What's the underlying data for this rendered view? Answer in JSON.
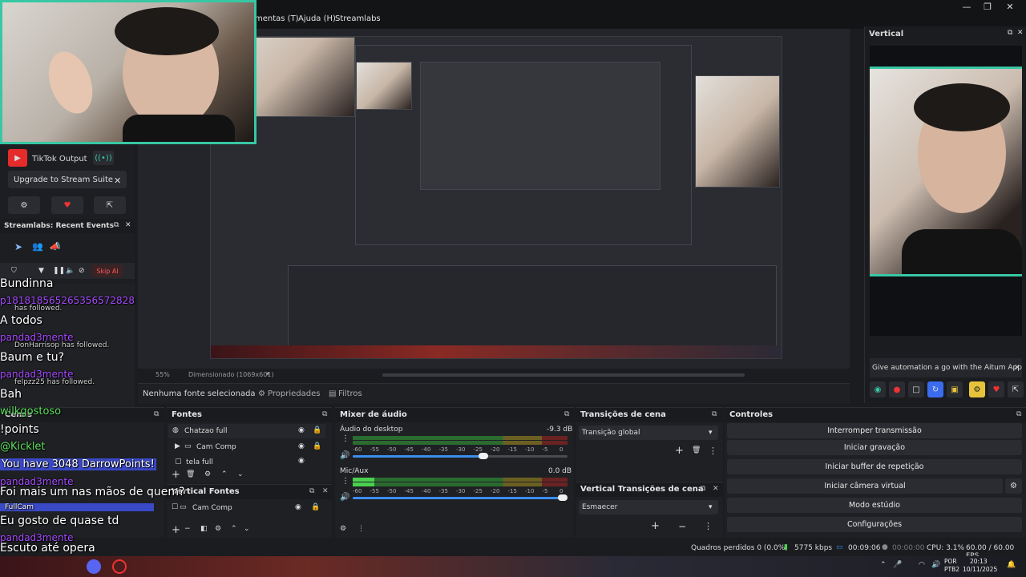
{
  "menu": {
    "items": [
      "mentas (T)",
      "Ajuda (H)",
      "Streamlabs"
    ]
  },
  "window_controls": {
    "minimize": "—",
    "restore": "❐",
    "close": "✕"
  },
  "left_panel": {
    "tiktok_label": "TikTok Output",
    "upgrade_label": "Upgrade to Stream Suite",
    "recent_events_title": "Streamlabs: Recent Events",
    "skip_label": "Skip Al"
  },
  "preview": {
    "zoom": "55%",
    "scaled_label": "Dimensionado (1069x601)"
  },
  "source_bar": {
    "no_source": "Nenhuma fonte selecionada",
    "properties": "Propriedades",
    "filters": "Filtros"
  },
  "scenes": {
    "title": "Cenas"
  },
  "sources": {
    "title": "Fontes",
    "items": [
      "Chatzao full",
      "Cam Comp",
      "tela full"
    ]
  },
  "vertical_sources": {
    "title": "Vertical Fontes",
    "items": [
      "Cam Comp"
    ]
  },
  "mixer": {
    "title": "Mixer de áudio",
    "channels": [
      {
        "name": "Áudio do desktop",
        "db": "-9.3 dB",
        "level": 0.0,
        "volume": 0.63
      },
      {
        "name": "Mic/Aux",
        "db": "0.0 dB",
        "level": 0.1,
        "volume": 1.0
      }
    ],
    "ticks": [
      "-60",
      "-55",
      "-50",
      "-45",
      "-40",
      "-35",
      "-30",
      "-25",
      "-20",
      "-15",
      "-10",
      "-5",
      "0"
    ]
  },
  "transitions": {
    "title": "Transições de cena",
    "selected": "Transição global"
  },
  "vertical_transitions": {
    "title": "Vertical Transições de cena",
    "selected": "Esmaecer"
  },
  "controls": {
    "title": "Controles",
    "buttons": [
      "Interromper transmissão",
      "Iniciar gravação",
      "Iniciar buffer de repetição",
      "Iniciar câmera virtual",
      "Modo estúdio",
      "Configurações"
    ]
  },
  "vertical": {
    "title": "Vertical",
    "automation_text": "Give automation a go with the Aitum App"
  },
  "status": {
    "dropped": "Quadros perdidos 0 (0.0%)",
    "bitrate": "5775 kbps",
    "stream_time": "00:09:06",
    "rec_time": "00:00:00",
    "cpu": "CPU: 3.1%",
    "fps": "60.00 / 60.00 FPS"
  },
  "taskbar": {
    "lang": "POR",
    "layout": "PTB2",
    "time": "20:13",
    "date": "10/11/2025"
  },
  "chat_overlay": [
    {
      "text": "Bundinna",
      "type": "msg"
    },
    {
      "text": "p181818565265356572828",
      "type": "user"
    },
    {
      "text": "has followed.",
      "type": "event"
    },
    {
      "text": "A todos",
      "type": "msg"
    },
    {
      "text": "pandad3mente",
      "type": "user"
    },
    {
      "text": "DonHarrisop has followed.",
      "type": "event"
    },
    {
      "text": "Baum e tu?",
      "type": "msg"
    },
    {
      "text": "pandad3mente",
      "type": "user"
    },
    {
      "text": "felpzz25 has followed.",
      "type": "event"
    },
    {
      "text": "Bah",
      "type": "msg"
    },
    {
      "text": "wilkgostoso",
      "type": "user-green"
    },
    {
      "text": "!points",
      "type": "msg"
    },
    {
      "text": "@Kicklet",
      "type": "user-green"
    },
    {
      "text": "You have 3048 DarrowPoints!",
      "type": "highlight"
    },
    {
      "text": "pandad3mente",
      "type": "user"
    },
    {
      "text": "Foi mais um nas mãos de quem?",
      "type": "msg"
    },
    {
      "text": "FullCam",
      "type": "scene"
    },
    {
      "text": "Eu gosto de quase td",
      "type": "msg"
    },
    {
      "text": "pandad3mente",
      "type": "user"
    },
    {
      "text": "Escuto até opera",
      "type": "msg"
    }
  ],
  "colors": {
    "accent_green": "#37c7a4",
    "chat_user": "#a64bff",
    "chat_green": "#5de05d",
    "highlight": "#3a49c6"
  }
}
